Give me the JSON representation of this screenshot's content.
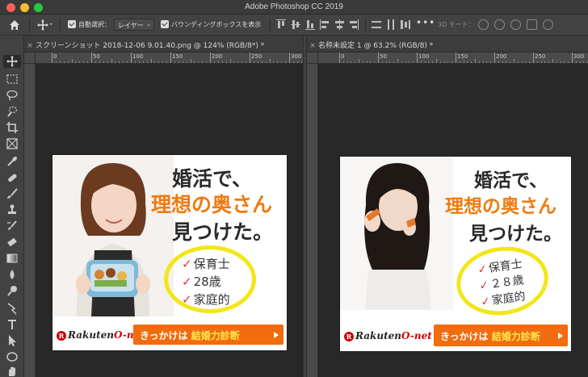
{
  "app": {
    "title": "Adobe Photoshop CC 2019"
  },
  "options_bar": {
    "auto_select_label": "自動選択：",
    "auto_select_value": "レイヤー",
    "bounding_box_label": "バウンディングボックスを表示",
    "more_label": "•••",
    "mode_3d_label": "3D モード："
  },
  "documents": [
    {
      "tab_title": "スクリーンショット 2018-12-06 9.01.40.png @ 124% (RGB/8*) *",
      "ruler_ticks": [
        "0",
        "50",
        "100",
        "150",
        "200",
        "250",
        "300"
      ],
      "ad": {
        "headline_1": "婚活で、",
        "headline_2": "理想の奥さん",
        "headline_3": "見つけた。",
        "bullets": [
          "保育士",
          "28歳",
          "家庭的"
        ],
        "logo_rakuten": "Rakuten",
        "logo_onet": "O-net",
        "cta_prefix": "きっかけは",
        "cta_highlight": "結婚力診断"
      }
    },
    {
      "tab_title": "名称未設定 1 @ 63.2% (RGB/8) *",
      "ruler_ticks": [
        "0",
        "50",
        "100",
        "150",
        "200",
        "250",
        "300"
      ],
      "ad": {
        "headline_1": "婚活で、",
        "headline_2": "理想の奥さん",
        "headline_3": "見つけた。",
        "bullets": [
          "保育士",
          "２８歳",
          "家庭的"
        ],
        "logo_rakuten": "Rakuten",
        "logo_onet": "O-net",
        "cta_prefix": "きっかけは",
        "cta_highlight": "結婚力診断"
      }
    }
  ],
  "colors": {
    "accent_orange": "#f07a10",
    "cta_orange": "#f26b0f",
    "circle_yellow": "#f2e61a",
    "rakuten_red": "#cc0000"
  }
}
